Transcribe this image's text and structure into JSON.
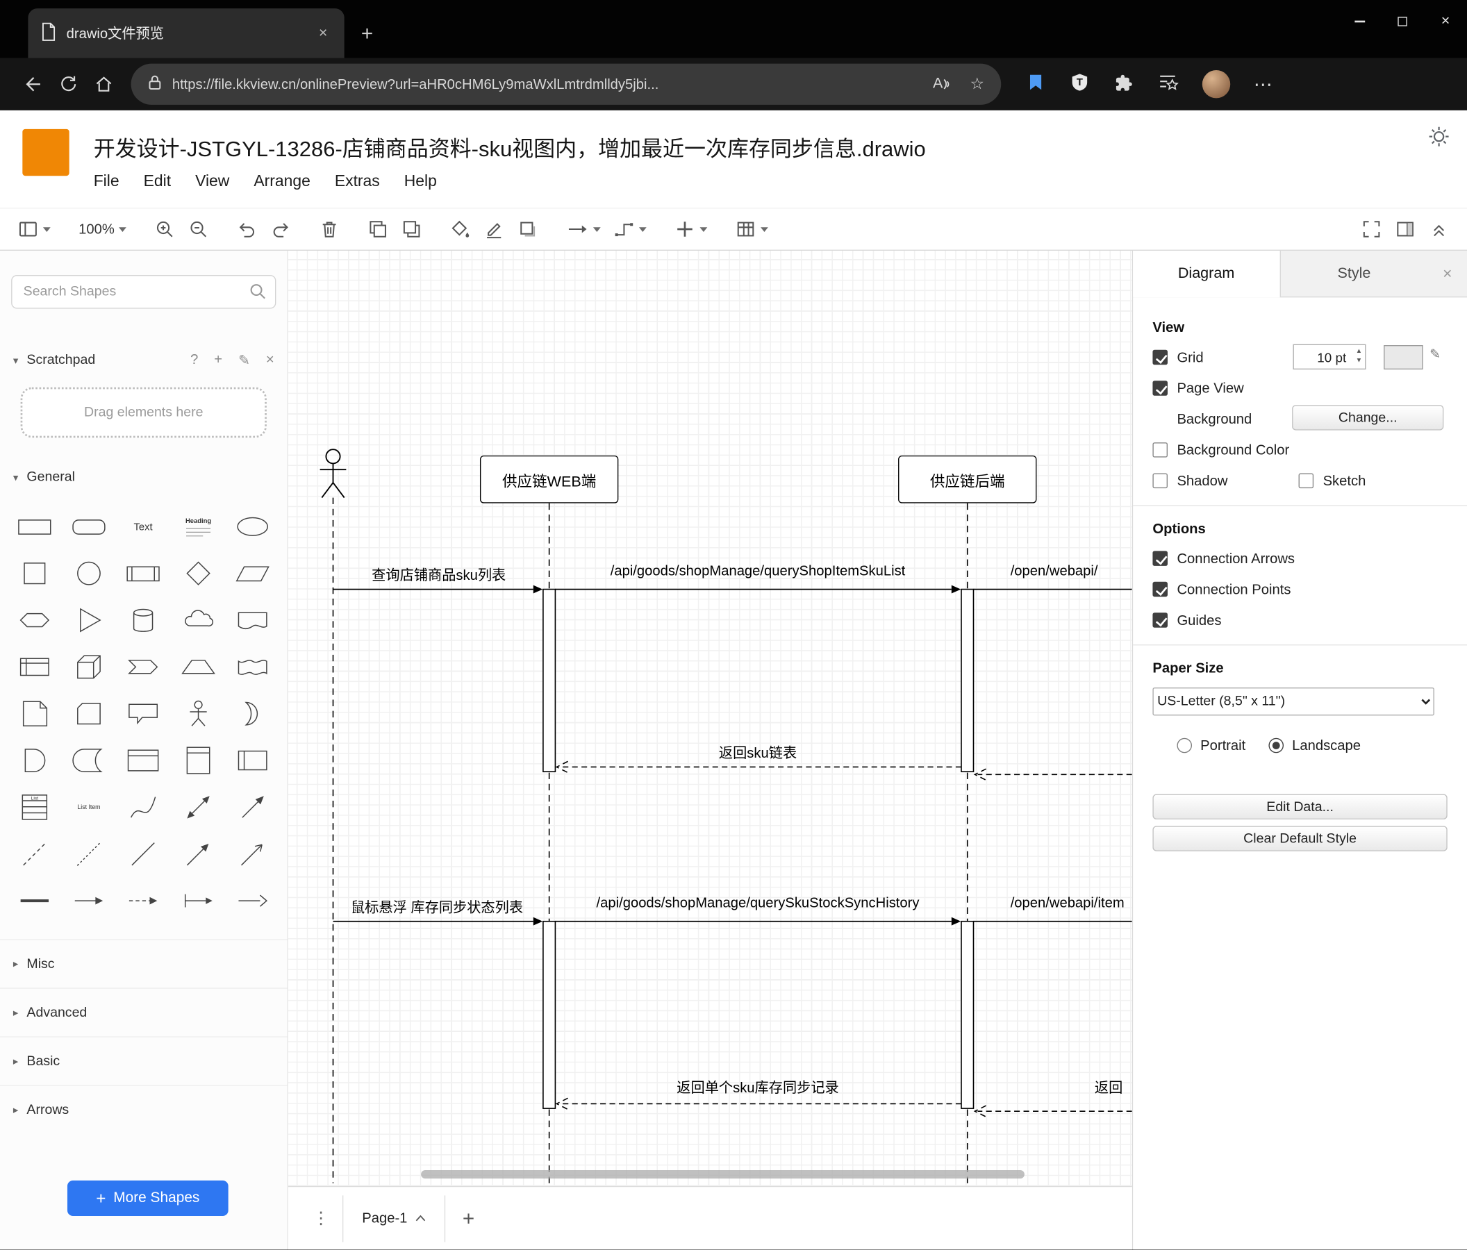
{
  "browser": {
    "tab_title": "drawio文件预览",
    "url": "https://file.kkview.cn/onlinePreview?url=aHR0cHM6Ly9maWxlLmtrdmlldy5jbi..."
  },
  "app": {
    "title": "开发设计-JSTGYL-13286-店铺商品资料-sku视图内，增加最近一次库存同步信息.drawio",
    "menu": [
      "File",
      "Edit",
      "View",
      "Arrange",
      "Extras",
      "Help"
    ],
    "zoom": "100%"
  },
  "shapes_panel": {
    "search_placeholder": "Search Shapes",
    "scratchpad_title": "Scratchpad",
    "scratchpad_hint": "Drag elements here",
    "sections": [
      "General",
      "Misc",
      "Advanced",
      "Basic",
      "Arrows"
    ],
    "more_shapes": "More Shapes",
    "glyph_text": "Text",
    "glyph_heading": "Heading",
    "glyph_list": "List",
    "glyph_list_item": "List Item"
  },
  "canvas": {
    "participants": {
      "web": "供应链WEB端",
      "backend": "供应链后端"
    },
    "messages": {
      "m1": "查询店铺商品sku列表",
      "m2": "/api/goods/shopManage/queryShopItemSkuList",
      "m3": "/open/webapi/",
      "r1": "返回sku链表",
      "m4": "鼠标悬浮 库存同步状态列表",
      "m5": "/api/goods/shopManage/querySkuStockSyncHistory",
      "m6": "/open/webapi/item",
      "r2": "返回单个sku库存同步记录",
      "r3": "返回"
    },
    "page_tab": "Page-1"
  },
  "format_panel": {
    "tab_diagram": "Diagram",
    "tab_style": "Style",
    "view_heading": "View",
    "grid_label": "Grid",
    "grid_size": "10 pt",
    "page_view": "Page View",
    "background_label": "Background",
    "change_button": "Change...",
    "background_color": "Background Color",
    "shadow": "Shadow",
    "sketch": "Sketch",
    "options_heading": "Options",
    "connection_arrows": "Connection Arrows",
    "connection_points": "Connection Points",
    "guides": "Guides",
    "paper_size_heading": "Paper Size",
    "paper_size_value": "US-Letter (8,5\" x 11\")",
    "portrait": "Portrait",
    "landscape": "Landscape",
    "edit_data": "Edit Data...",
    "clear_default_style": "Clear Default Style"
  },
  "colors": {
    "drawio_orange": "#F08705",
    "more_shapes_blue": "#2E77F2",
    "canvas_grid": "#E2E2E2"
  }
}
